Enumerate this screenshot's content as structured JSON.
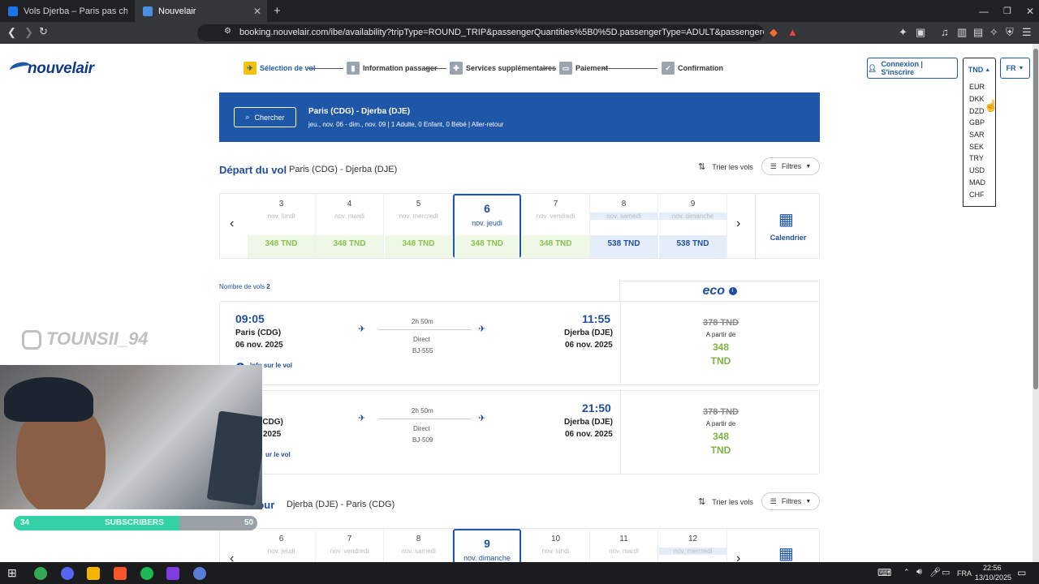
{
  "browser": {
    "tabs": [
      {
        "title": "Vols Djerba – Paris pas chers sur Skys",
        "active": false
      },
      {
        "title": "Nouvelair",
        "active": true
      }
    ],
    "url": "booking.nouvelair.com/ibe/availability?tripType=ROUND_TRIP&passengerQuantities%5B0%5D.passengerType=ADULT&passengerQuantities%5B0%5D.q..."
  },
  "header": {
    "logo": "nouvelair",
    "steps": [
      "Sélection de vol",
      "Information passager",
      "Services supplémentaires",
      "Paiement",
      "Confirmation"
    ],
    "login": "Connexion | S'inscrire",
    "currency": "TND",
    "language": "FR",
    "currency_options": [
      "EUR",
      "DKK",
      "DZD",
      "GBP",
      "SAR",
      "SEK",
      "TRY",
      "USD",
      "MAD",
      "CHF"
    ]
  },
  "search": {
    "button": "Chercher",
    "route": "Paris (CDG) - Djerba (DJE)",
    "details": "jeu., nov. 06 - dim., nov. 09   |   1 Adulte, 0 Enfant, 0 Bébé   |   Aller-retour"
  },
  "outbound": {
    "title": "Départ du vol",
    "route": "Paris (CDG) - Djerba (DJE)",
    "sort": "Trier les vols",
    "filters": "Filtres",
    "calendar": "Calendrier",
    "dates": [
      {
        "day": "3",
        "weekday": "nov. lundi",
        "price": "348 TND"
      },
      {
        "day": "4",
        "weekday": "nov. mardi",
        "price": "348 TND"
      },
      {
        "day": "5",
        "weekday": "nov. mercredi",
        "price": "348 TND"
      },
      {
        "day": "6",
        "weekday": "nov. jeudi",
        "price": "348 TND"
      },
      {
        "day": "7",
        "weekday": "nov. vendredi",
        "price": "348 TND"
      },
      {
        "day": "8",
        "weekday": "nov. samedi",
        "price": "538 TND"
      },
      {
        "day": "9",
        "weekday": "nov. dimanche",
        "price": "538 TND"
      }
    ],
    "count_label": "Nombre de vols",
    "count": "2",
    "cabin": "eco",
    "flights": [
      {
        "dep_time": "09:05",
        "dep_city": "Paris (CDG)",
        "dep_date": "06 nov. 2025",
        "duration": "2h 50m",
        "stops": "Direct",
        "number": "BJ-555",
        "arr_time": "11:55",
        "arr_city": "Djerba (DJE)",
        "arr_date": "06 nov. 2025",
        "old_price": "378 TND",
        "from": "A partir de",
        "price": "348",
        "currency": "TND",
        "info": "Info sur le vol"
      },
      {
        "dep_time": "",
        "dep_city": "(CDG)",
        "dep_date": "2025",
        "duration": "2h 50m",
        "stops": "Direct",
        "number": "BJ-509",
        "arr_time": "21:50",
        "arr_city": "Djerba (DJE)",
        "arr_date": "06 nov. 2025",
        "old_price": "378 TND",
        "from": "A partir de",
        "price": "348",
        "currency": "TND",
        "info": "ur le vol"
      }
    ]
  },
  "return": {
    "title": "tour",
    "route": "Djerba (DJE) - Paris (CDG)",
    "sort": "Trier les vols",
    "filters": "Filtres",
    "dates": [
      {
        "day": "6",
        "weekday": "nov. jeudi"
      },
      {
        "day": "7",
        "weekday": "nov. vendredi"
      },
      {
        "day": "8",
        "weekday": "nov. samedi"
      },
      {
        "day": "9",
        "weekday": "nov. dimanche"
      },
      {
        "day": "10",
        "weekday": "nov. lundi"
      },
      {
        "day": "11",
        "weekday": "nov. mardi"
      },
      {
        "day": "12",
        "weekday": "nov. mercredi"
      }
    ]
  },
  "overlay": {
    "watermark": "TOUNSII_94",
    "sub_left": "34",
    "sub_label": "SUBSCRIBERS",
    "sub_right": "50",
    "sub_progress": 0.68
  },
  "taskbar": {
    "lang": "FRA",
    "time": "22:56",
    "date": "13/10/2025"
  },
  "colors": {
    "brand": "#1e56a8",
    "price_green": "#8cc152",
    "accent_yellow": "#f4c20d"
  }
}
